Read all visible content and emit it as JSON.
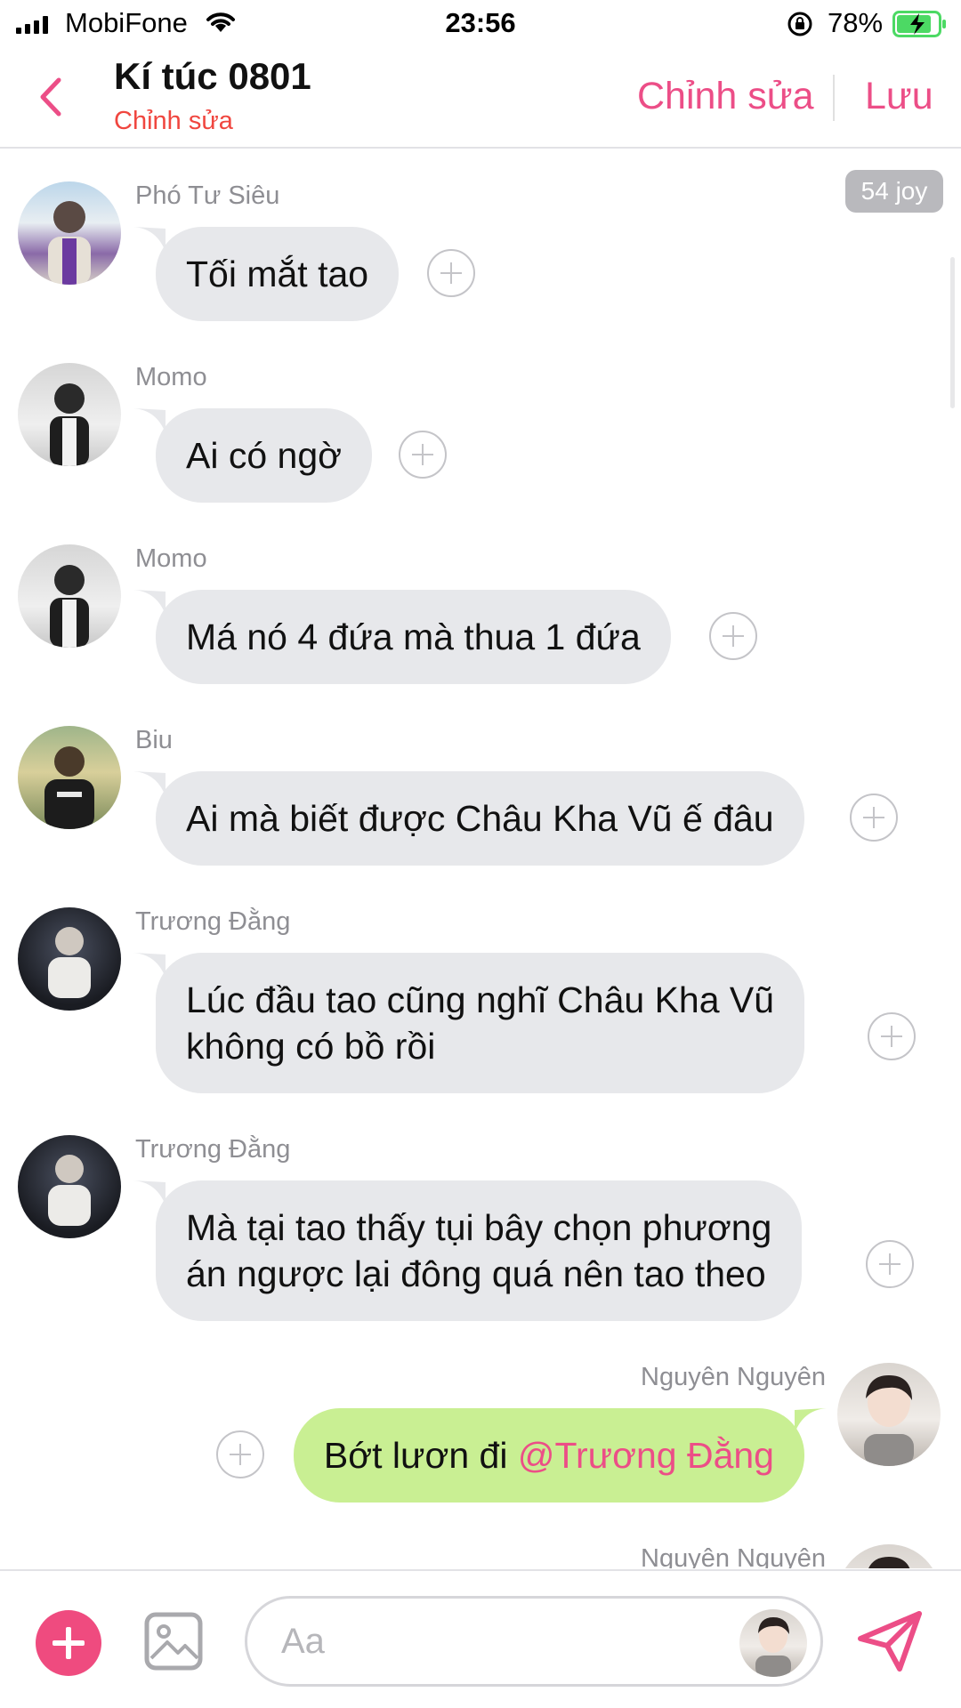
{
  "status_bar": {
    "carrier": "MobiFone",
    "time": "23:56",
    "battery_percent": "78%",
    "battery_level": 0.78,
    "icons": [
      "signal-icon",
      "wifi-icon",
      "rotation-lock-icon",
      "battery-charging-icon"
    ]
  },
  "header": {
    "title": "Kí túc 0801",
    "subtitle": "Chỉnh sửa",
    "edit_label": "Chỉnh sửa",
    "save_label": "Lưu",
    "back_icon": "chevron-left-icon"
  },
  "joy_badge": "54 joy",
  "messages": [
    {
      "sender": "Phó Tư Siêu",
      "text": "Tối mắt tao",
      "direction": "incoming"
    },
    {
      "sender": "Momo",
      "text": "Ai có ngờ",
      "direction": "incoming"
    },
    {
      "sender": "Momo",
      "text": "Má nó 4 đứa mà thua 1 đứa",
      "direction": "incoming"
    },
    {
      "sender": "Biu",
      "text": "Ai mà biết được Châu Kha Vũ ế đâu",
      "direction": "incoming"
    },
    {
      "sender": "Trương Đằng",
      "lines": [
        "Lúc đầu tao cũng nghĩ Châu Kha Vũ",
        "không có bồ rồi"
      ],
      "direction": "incoming"
    },
    {
      "sender": "Trương Đằng",
      "lines": [
        "Mà tại tao thấy tụi bây chọn phương",
        "án ngược lại đông quá nên tao theo"
      ],
      "direction": "incoming"
    },
    {
      "sender": "Nguyên Nguyên",
      "text": "Bớt lươn đi ",
      "mention": "@Trương Đằng",
      "direction": "outgoing"
    },
    {
      "sender": "Nguyên Nguyên",
      "direction": "outgoing"
    }
  ],
  "composer": {
    "placeholder": "Aa",
    "icons": [
      "plus-icon",
      "image-icon",
      "send-icon"
    ]
  },
  "colors": {
    "accent_pink": "#ec4e87",
    "subtitle_red": "#f0463f",
    "incoming_bubble": "#e7e8eb",
    "outgoing_bubble": "#c9ef93",
    "battery_green": "#4cd964"
  }
}
